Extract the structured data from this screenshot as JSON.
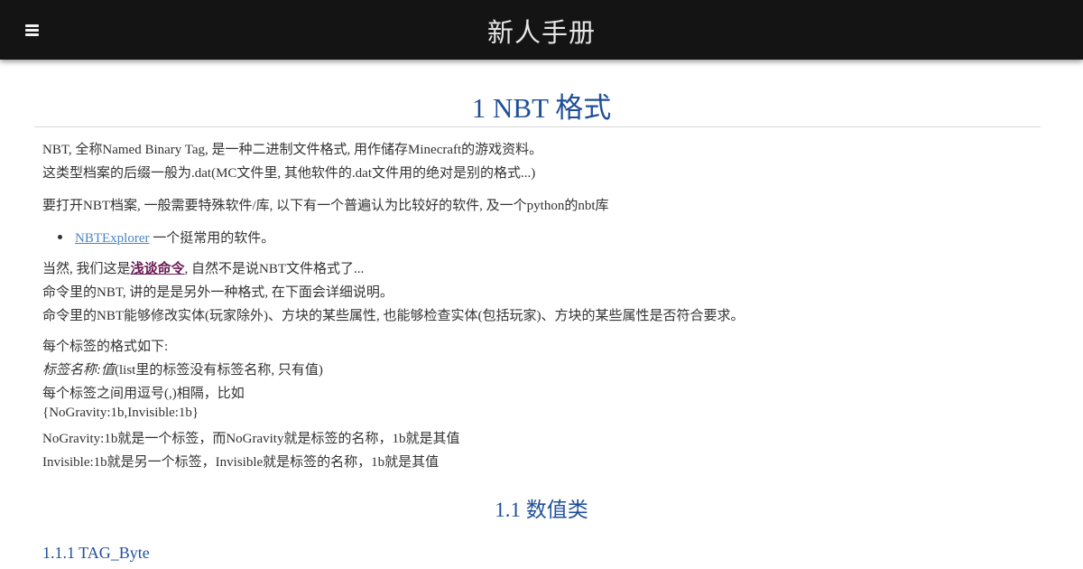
{
  "header": {
    "site_title": "新人手册",
    "menu_icon": "hamburger-menu-icon"
  },
  "article": {
    "h1": "1 NBT 格式",
    "para1_line1": "NBT, 全称Named Binary Tag, 是一种二进制文件格式, 用作储存Minecraft的游戏资料。",
    "para1_line2": "这类型档案的后缀一般为.dat(MC文件里, 其他软件的.dat文件用的绝对是别的格式...)",
    "para2": "要打开NBT档案, 一般需要特殊软件/库, 以下有一个普遍认为比较好的软件, 及一个python的nbt库",
    "bullet_link": "NBTExplorer",
    "bullet_text": " 一个挺常用的软件。",
    "para3_prefix": "当然, 我们这是",
    "para3_link": "浅谈命令",
    "para3_suffix": ", 自然不是说NBT文件格式了...",
    "para3_line2": "命令里的NBT, 讲的是是另外一种格式, 在下面会详细说明。",
    "para3_line3": "命令里的NBT能够修改实体(玩家除外)、方块的某些属性, 也能够检查实体(包括玩家)、方块的某些属性是否符合要求。",
    "para4_line1": "每个标签的格式如下:",
    "para4_line2_italic": "标签名称:值",
    "para4_line2_rest": "(list里的标签没有标签名称, 只有值)",
    "para4_line3": "每个标签之间用逗号(,)相隔，比如",
    "para4_line4": "{NoGravity:1b,Invisible:1b}",
    "para4_line5": "NoGravity:1b就是一个标签，而NoGravity就是标签的名称，1b就是其值",
    "para4_line6": "Invisible:1b就是另一个标签，Invisible就是标签的名称，1b就是其值",
    "h2": "1.1 数值类",
    "h3": "1.1.1 TAG_Byte"
  },
  "colors": {
    "topbar_bg": "#141414",
    "heading": "#1f4f99",
    "link": "#4a86c5",
    "strong_link": "#6a1a55",
    "body_text": "#333333"
  }
}
